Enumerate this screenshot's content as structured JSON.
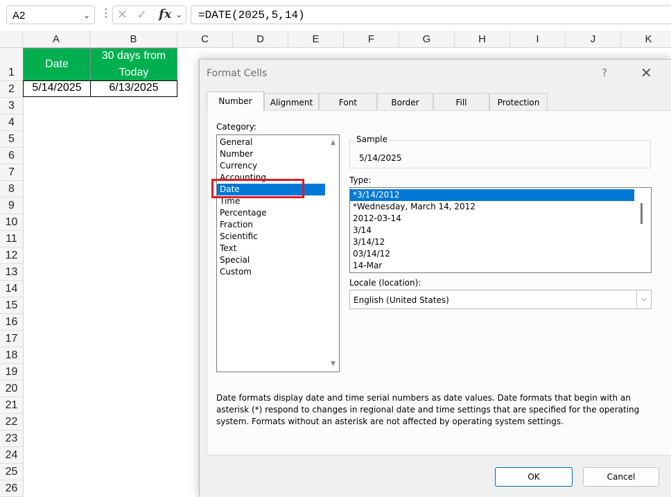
{
  "formula_bar": {
    "name_box": "A2",
    "fx_label": "fx",
    "formula": "=DATE(2025,5,14)"
  },
  "columns": [
    "A",
    "B",
    "C",
    "D",
    "E",
    "F",
    "G",
    "H",
    "I",
    "J",
    "K"
  ],
  "rows": [
    "1",
    "2",
    "3",
    "4",
    "5",
    "6",
    "7",
    "8",
    "9",
    "10",
    "11",
    "12",
    "13",
    "14",
    "15",
    "16",
    "17",
    "18",
    "19",
    "20",
    "21",
    "22",
    "23",
    "24",
    "25",
    "26"
  ],
  "sheet": {
    "header_a": "Date",
    "header_b": "30 days from Today",
    "a2": "5/14/2025",
    "b2": "6/13/2025",
    "header_color": "#00b050"
  },
  "dialog": {
    "title": "Format Cells",
    "help": "?",
    "tabs": [
      "Number",
      "Alignment",
      "Font",
      "Border",
      "Fill",
      "Protection"
    ],
    "active_tab": "Number",
    "category_label": "Category:",
    "categories": [
      "General",
      "Number",
      "Currency",
      "Accounting",
      "Date",
      "Time",
      "Percentage",
      "Fraction",
      "Scientific",
      "Text",
      "Special",
      "Custom"
    ],
    "selected_category": "Date",
    "sample_label": "Sample",
    "sample_value": "5/14/2025",
    "type_label": "Type:",
    "types": [
      "*3/14/2012",
      "*Wednesday, March 14, 2012",
      "2012-03-14",
      "3/14",
      "3/14/12",
      "03/14/12",
      "14-Mar"
    ],
    "selected_type": "*3/14/2012",
    "locale_label": "Locale (location):",
    "locale_value": "English (United States)",
    "description": "Date formats display date and time serial numbers as date values.  Date formats that begin with an asterisk (*) respond to changes in regional date and time settings that are specified for the operating system. Formats without an asterisk are not affected by operating system settings.",
    "ok_label": "OK",
    "cancel_label": "Cancel",
    "highlight_color": "#e01b24",
    "selection_color": "#0078d7"
  }
}
